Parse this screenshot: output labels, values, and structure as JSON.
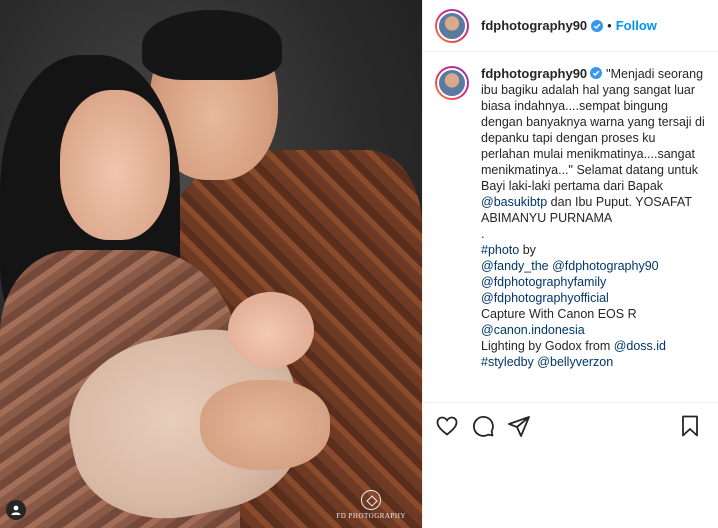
{
  "photo": {
    "watermark_text": "FD PHOTOGRAPHY",
    "user_tag_icon": "user-icon"
  },
  "header": {
    "username": "fdphotography90",
    "verified_icon": "verified-badge-icon",
    "separator": "•",
    "follow_label": "Follow"
  },
  "caption": {
    "username": "fdphotography90",
    "text_part1": "\"Menjadi seorang ibu bagiku adalah hal yang sangat luar biasa indahnya....sempat bingung dengan banyaknya warna yang tersaji di depanku tapi dengan proses ku perlahan mulai menikmatinya....sangat menikmatinya...\" Selamat datang untuk Bayi laki-laki pertama dari Bapak ",
    "mention_basuki": "@basukibtp",
    "text_part2": " dan Ibu Puput. YOSAFAT ABIMANYU PURNAMA",
    "dot_line": ".",
    "hashtag_photo": "#photo",
    "by_word": " by",
    "mention_fandy": "@fandy_the",
    "mention_fdphotography90": "@fdphotography90",
    "mention_family": "@fdphotographyfamily",
    "mention_official": "@fdphotographyofficial",
    "capture_text": "Capture With Canon EOS R",
    "mention_canon": "@canon.indonesia",
    "lighting_text": "Lighting by Godox from ",
    "mention_doss": "@doss.id",
    "hashtag_styledby": "#styledby",
    "mention_belly": "@bellyverzon"
  },
  "actions": {
    "like_icon": "heart-icon",
    "comment_icon": "comment-icon",
    "share_icon": "share-icon",
    "save_icon": "bookmark-icon"
  },
  "colors": {
    "follow": "#0095f6",
    "link": "#00376b",
    "verified": "#3897f0"
  }
}
